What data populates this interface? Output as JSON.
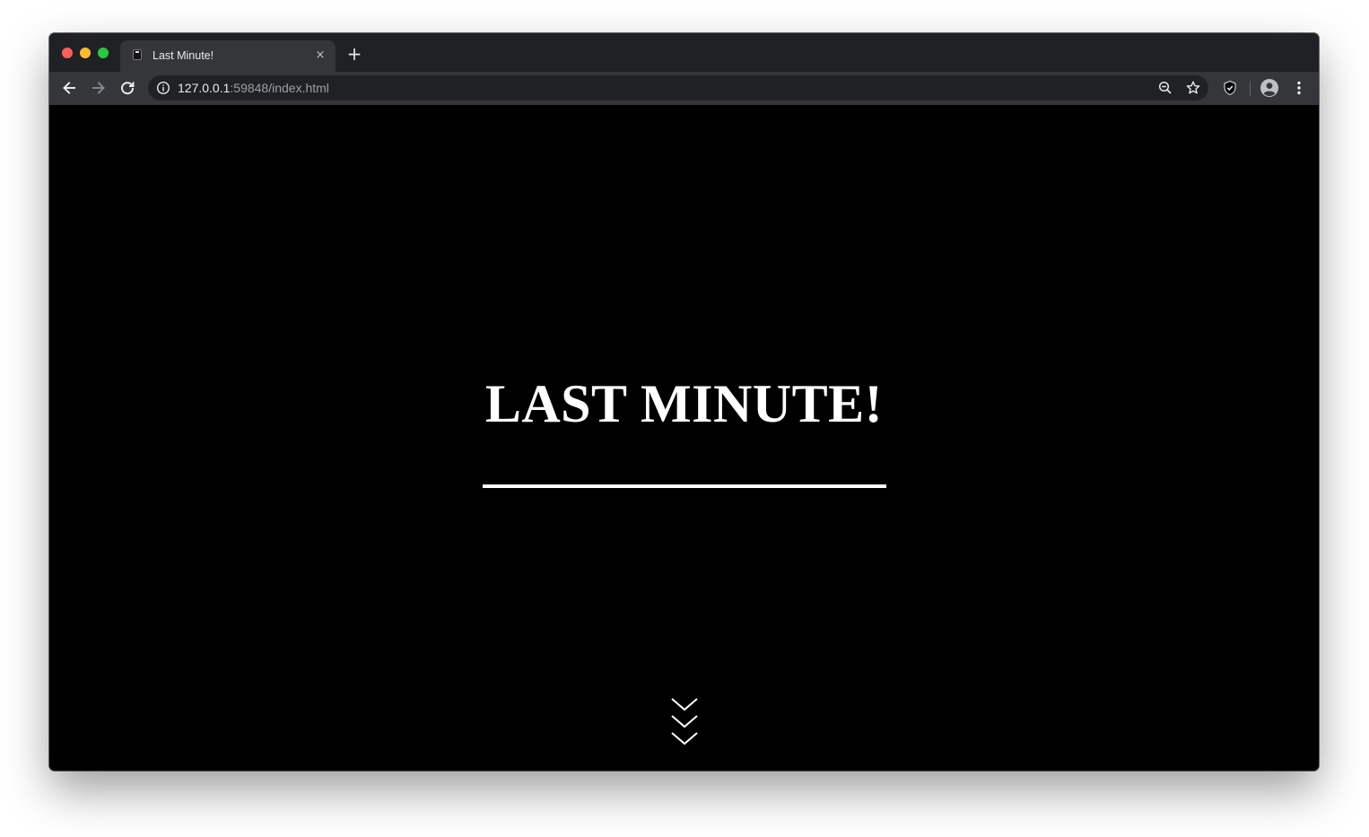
{
  "browser": {
    "tab": {
      "title": "Last Minute!",
      "close_glyph": "×",
      "favicon": "page-favicon"
    },
    "new_tab_glyph": "+",
    "address": {
      "host": "127.0.0.1",
      "rest": ":59848/index.html"
    },
    "icons": {
      "back": "arrow-left-icon",
      "forward": "arrow-right-icon",
      "reload": "reload-icon",
      "site_info": "info-icon",
      "zoom": "zoom-out-icon",
      "bookmark": "star-icon",
      "extension": "shield-icon",
      "profile": "avatar-icon",
      "menu": "kebab-menu-icon"
    },
    "colors": {
      "frame": "#202124",
      "toolbar": "#35363a",
      "omnibox": "#202124",
      "text": "#e8eaed",
      "muted": "#9aa0a6"
    }
  },
  "page": {
    "heading": "LAST MINUTE!",
    "background": "#000000",
    "foreground": "#ffffff",
    "scroll_indicator": "triple-chevron-down-icon"
  }
}
